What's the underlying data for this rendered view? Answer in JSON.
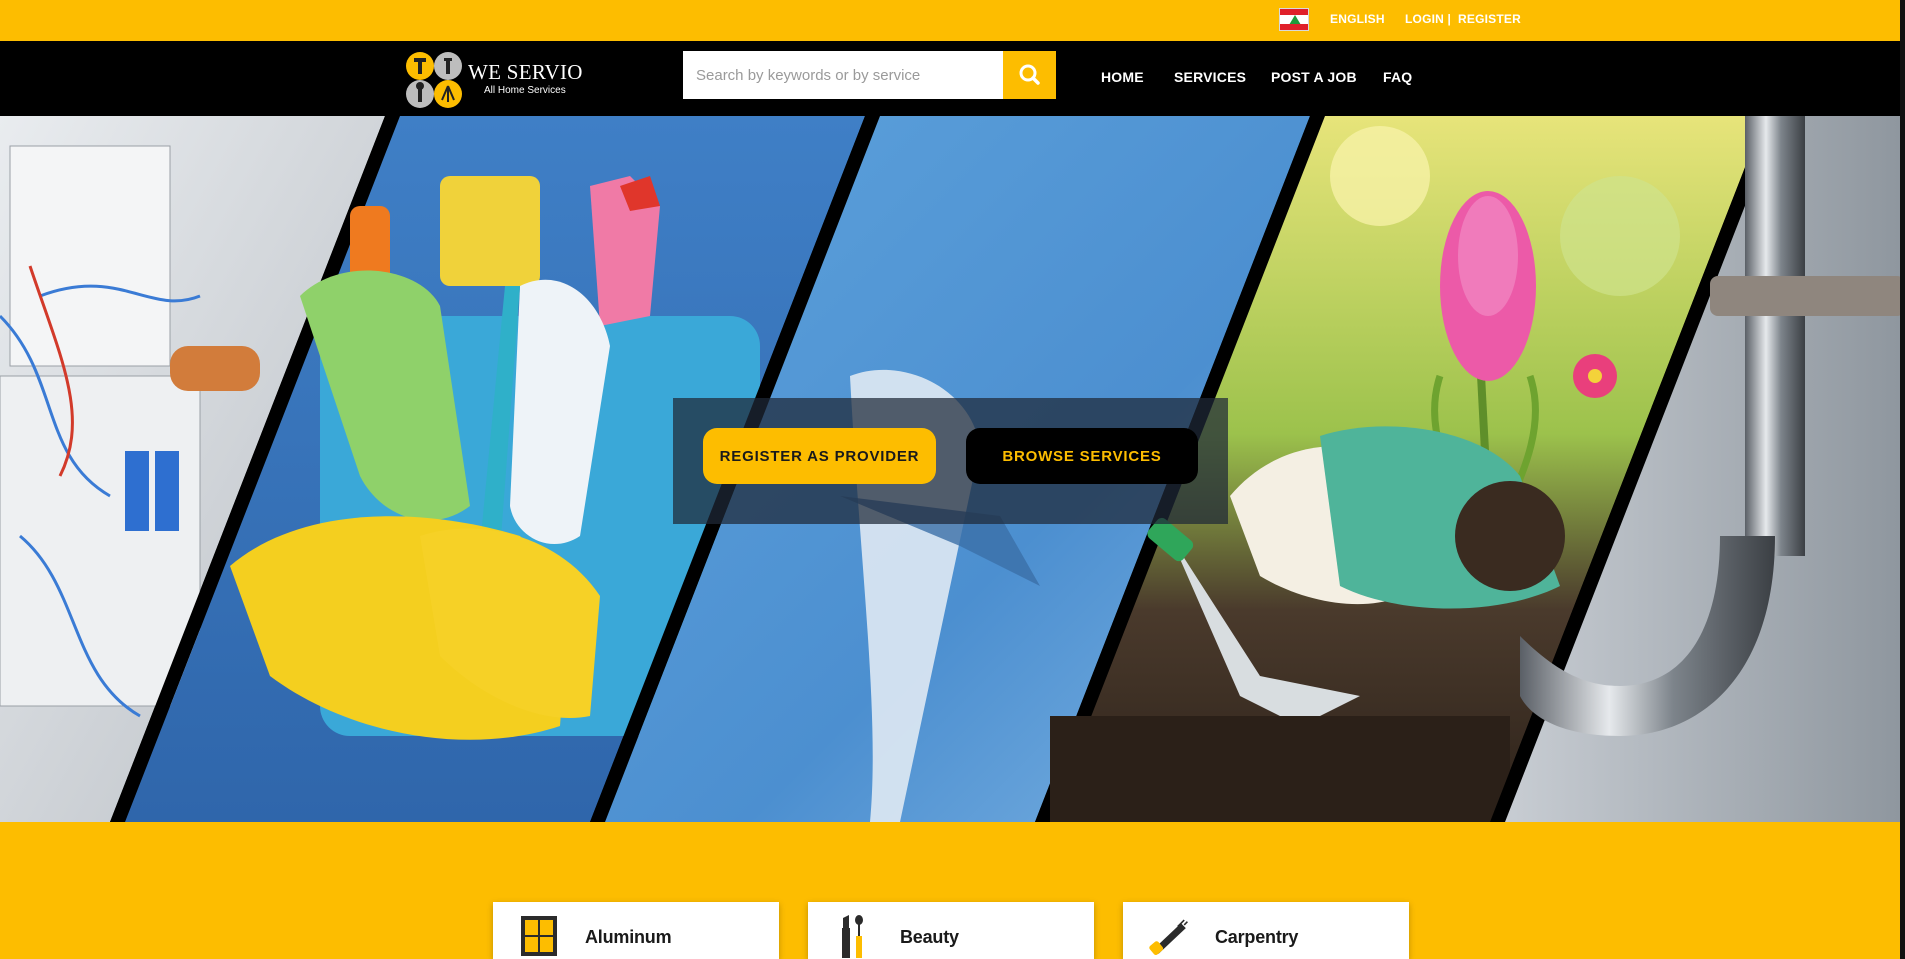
{
  "topbar": {
    "flag_icon": "lebanon-flag-icon",
    "language": "ENGLISH",
    "login": "LOGIN |",
    "register": "REGISTER",
    "background_color": "#fdbd00"
  },
  "header": {
    "logo_title": "WE SERVIO",
    "logo_subtitle": "All Home Services",
    "search": {
      "placeholder": "Search by keywords or by service",
      "value": "",
      "button_icon": "search-icon"
    },
    "nav": [
      {
        "label": "HOME"
      },
      {
        "label": "SERVICES"
      },
      {
        "label": "POST A JOB"
      },
      {
        "label": "FAQ"
      }
    ]
  },
  "hero": {
    "panels": [
      "electrician",
      "cleaning",
      "painting",
      "gardening",
      "plumbing"
    ],
    "register_button": "REGISTER AS PROVIDER",
    "browse_button": "BROWSE SERVICES"
  },
  "categories": [
    {
      "label": "Aluminum",
      "icon": "aluminum-window-icon"
    },
    {
      "label": "Beauty",
      "icon": "beauty-cosmetics-icon"
    },
    {
      "label": "Carpentry",
      "icon": "saw-icon"
    }
  ],
  "colors": {
    "accent": "#fdbd00",
    "dark": "#000000",
    "text_light": "#ffffff"
  }
}
